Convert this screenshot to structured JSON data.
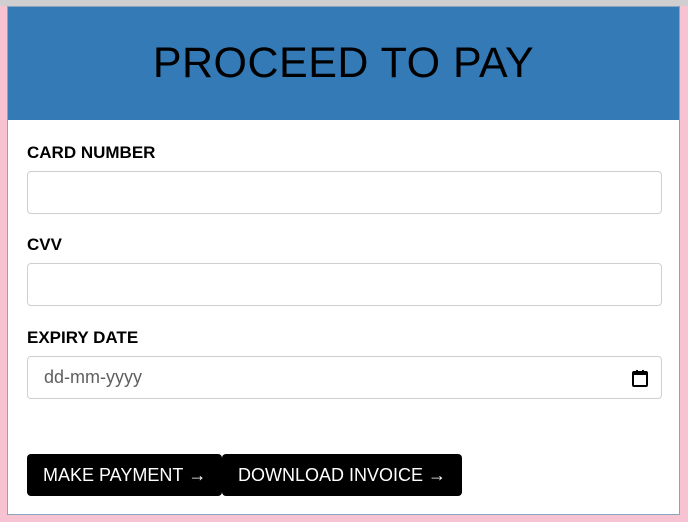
{
  "header": {
    "title": "PROCEED TO PAY"
  },
  "form": {
    "card_number": {
      "label": "CARD NUMBER",
      "value": "",
      "placeholder": ""
    },
    "cvv": {
      "label": "CVV",
      "value": "",
      "placeholder": ""
    },
    "expiry_date": {
      "label": "EXPIRY DATE",
      "placeholder": "dd-mm-yyyy",
      "icon": "calendar-icon"
    }
  },
  "buttons": {
    "make_payment": {
      "label": "MAKE PAYMENT",
      "arrow": "→"
    },
    "download_invoice": {
      "label": "DOWNLOAD INVOICE",
      "arrow": "→"
    }
  },
  "colors": {
    "page_background": "#f7c3d3",
    "header_background": "#337ab7",
    "button_background": "#000000",
    "button_text": "#ffffff"
  }
}
